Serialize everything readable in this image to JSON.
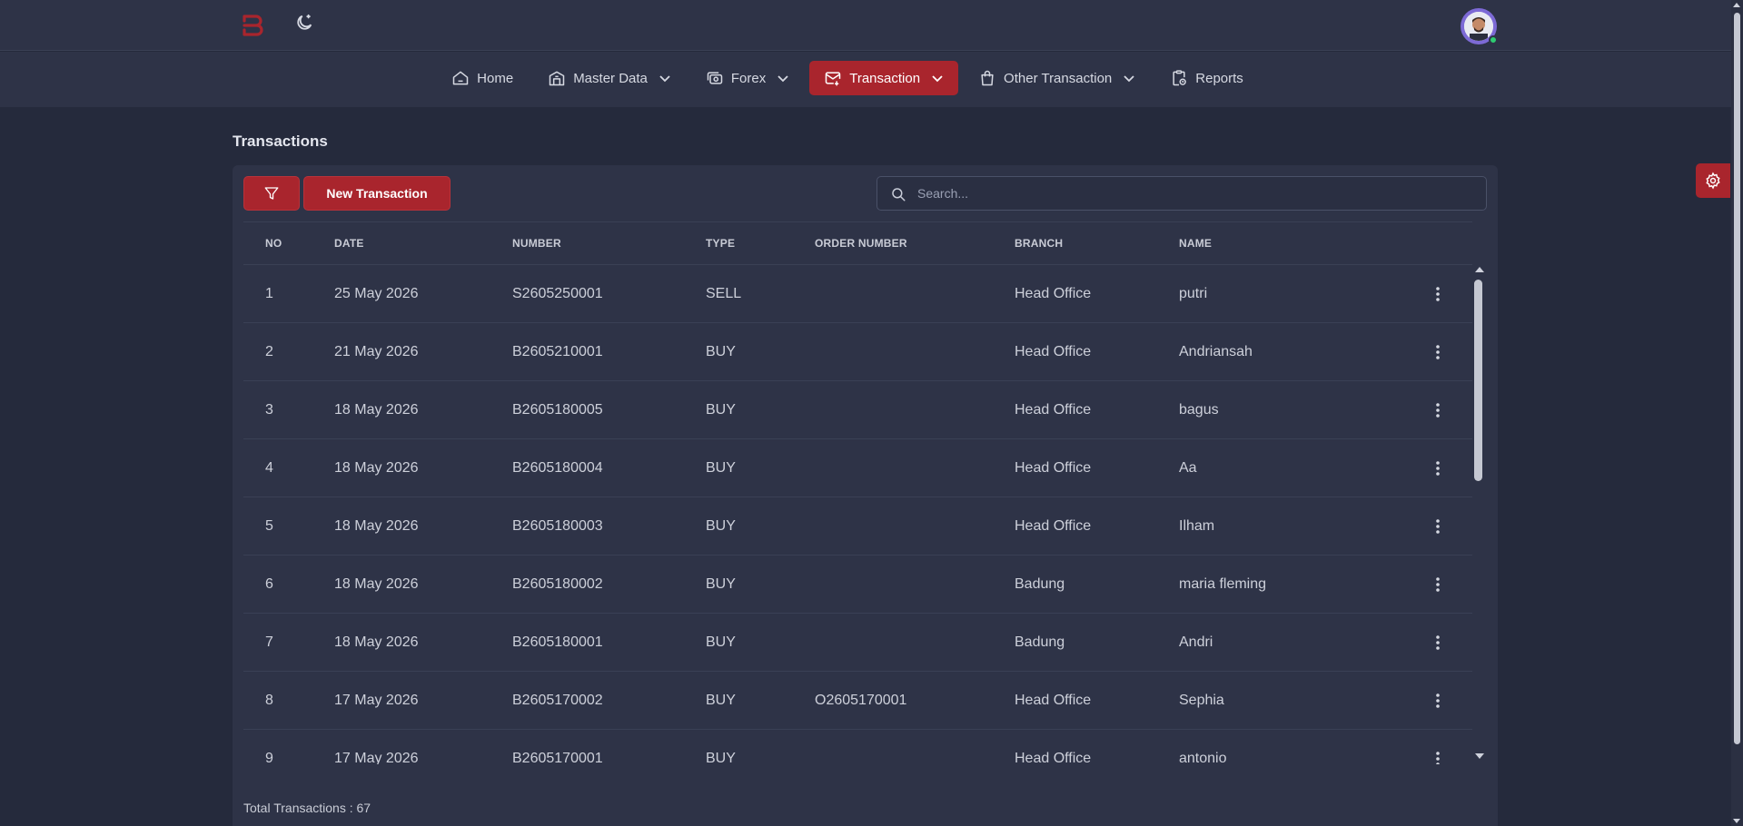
{
  "nav": {
    "items": [
      {
        "label": "Home",
        "icon": "home-icon",
        "dropdown": false
      },
      {
        "label": "Master Data",
        "icon": "building-icon",
        "dropdown": true
      },
      {
        "label": "Forex",
        "icon": "currency-exchange-icon",
        "dropdown": true
      },
      {
        "label": "Transaction",
        "icon": "mail-transaction-icon",
        "dropdown": true,
        "active": true
      },
      {
        "label": "Other Transaction",
        "icon": "shopping-bag-icon",
        "dropdown": true
      },
      {
        "label": "Reports",
        "icon": "clipboard-report-icon",
        "dropdown": false
      }
    ]
  },
  "colors": {
    "accent": "#a9252d",
    "background": "#252a3c",
    "surface": "#2e3347",
    "online": "#2ecc71"
  },
  "page": {
    "title": "Transactions"
  },
  "toolbar": {
    "new_label": "New Transaction",
    "filter_icon": "filter-icon"
  },
  "search": {
    "placeholder": "Search...",
    "value": ""
  },
  "table": {
    "columns": [
      "NO",
      "DATE",
      "NUMBER",
      "TYPE",
      "ORDER NUMBER",
      "BRANCH",
      "NAME"
    ],
    "rows": [
      {
        "no": "1",
        "date": "25 May 2026",
        "number": "S2605250001",
        "type": "SELL",
        "order": "",
        "branch": "Head Office",
        "name": "putri"
      },
      {
        "no": "2",
        "date": "21 May 2026",
        "number": "B2605210001",
        "type": "BUY",
        "order": "",
        "branch": "Head Office",
        "name": "Andriansah"
      },
      {
        "no": "3",
        "date": "18 May 2026",
        "number": "B2605180005",
        "type": "BUY",
        "order": "",
        "branch": "Head Office",
        "name": "bagus"
      },
      {
        "no": "4",
        "date": "18 May 2026",
        "number": "B2605180004",
        "type": "BUY",
        "order": "",
        "branch": "Head Office",
        "name": "Aa"
      },
      {
        "no": "5",
        "date": "18 May 2026",
        "number": "B2605180003",
        "type": "BUY",
        "order": "",
        "branch": "Head Office",
        "name": "Ilham"
      },
      {
        "no": "6",
        "date": "18 May 2026",
        "number": "B2605180002",
        "type": "BUY",
        "order": "",
        "branch": "Badung",
        "name": "maria fleming"
      },
      {
        "no": "7",
        "date": "18 May 2026",
        "number": "B2605180001",
        "type": "BUY",
        "order": "",
        "branch": "Badung",
        "name": "Andri"
      },
      {
        "no": "8",
        "date": "17 May 2026",
        "number": "B2605170002",
        "type": "BUY",
        "order": "O2605170001",
        "branch": "Head Office",
        "name": "Sephia"
      },
      {
        "no": "9",
        "date": "17 May 2026",
        "number": "B2605170001",
        "type": "BUY",
        "order": "",
        "branch": "Head Office",
        "name": "antonio"
      }
    ]
  },
  "footer": {
    "total_text": "Total Transactions : 67"
  }
}
